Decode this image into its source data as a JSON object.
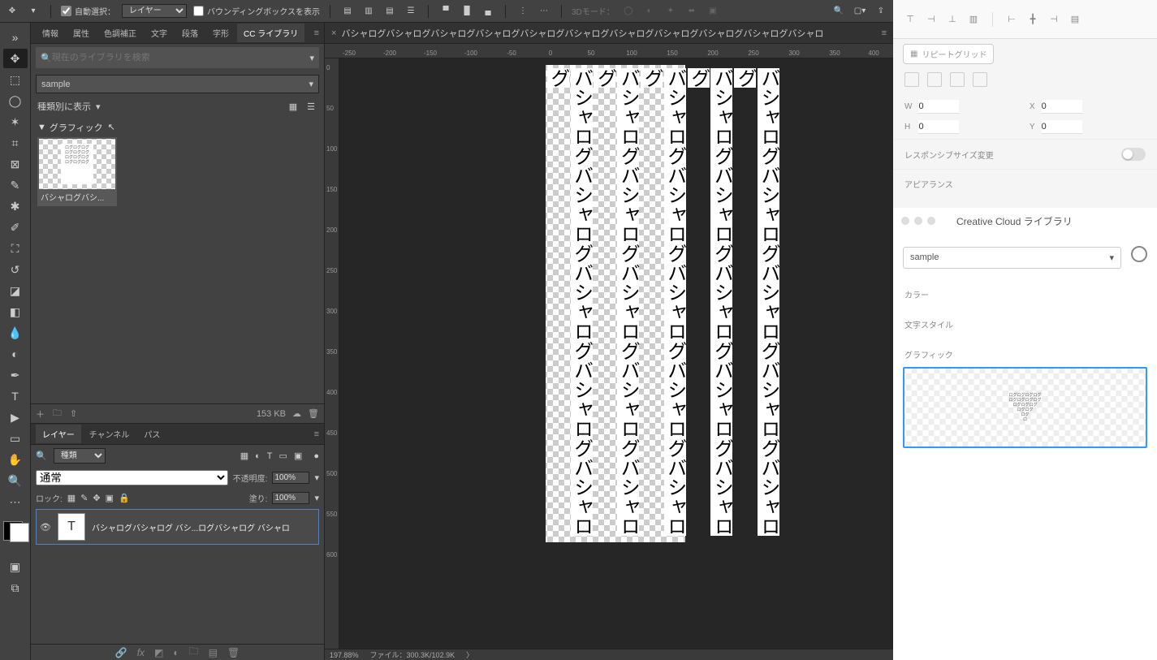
{
  "optionsBar": {
    "autoSelectLabel": "自動選択：",
    "selectTarget": "レイヤー",
    "boundingLabel": "バウンディングボックスを表示",
    "mode3d": "3Dモード："
  },
  "panelTabs": {
    "info": "情報",
    "attr": "属性",
    "color": "色調補正",
    "text": "文字",
    "para": "段落",
    "glyph": "字形",
    "cclib": "CC ライブラリ"
  },
  "library": {
    "searchPlaceholder": "現在のライブラリを検索",
    "selected": "sample",
    "viewLabel": "種類別に表示",
    "sectionGraphic": "グラフィック",
    "thumbCaption": "バシャログバシ...",
    "size": "153 KB"
  },
  "layersPanel": {
    "tabs": {
      "layers": "レイヤー",
      "channels": "チャンネル",
      "paths": "パス"
    },
    "kind": "種類",
    "blend": "通常",
    "opacityLabel": "不透明度:",
    "opacity": "100%",
    "lockLabel": "ロック:",
    "fillLabel": "塗り:",
    "fill": "100%",
    "layerName": "バシャログバシャログ バシ...ログバシャログ バシャロ"
  },
  "document": {
    "title": "バシャログバシャログバシャログバシャログバシャログバシャログバシャログバシャログバシャログバシャログバシャロ",
    "rulerH": [
      "-250",
      "-200",
      "-150",
      "-100",
      "-50",
      "0",
      "50",
      "100",
      "150",
      "200",
      "250",
      "300",
      "350",
      "400"
    ],
    "rulerV": [
      "0",
      "50",
      "100",
      "150",
      "200",
      "250",
      "300",
      "350",
      "400",
      "450",
      "500",
      "550",
      "600"
    ],
    "colText": "バシャログバシャログバシャログバシャログバシャログ",
    "zoom": "197.88%",
    "fileInfo": "ファイル：300.3K/102.9K"
  },
  "xd": {
    "repeatGrid": "リピートグリッド",
    "W": "W",
    "Wval": "0",
    "H": "H",
    "Hval": "0",
    "X": "X",
    "Xval": "0",
    "Y": "Y",
    "Yval": "0",
    "responsive": "レスポンシブサイズ変更",
    "appearance": "アピアランス"
  },
  "cc": {
    "title": "Creative Cloud ライブラリ",
    "select": "sample",
    "catColor": "カラー",
    "catTextStyle": "文字スタイル",
    "catGraphic": "グラフィック"
  }
}
